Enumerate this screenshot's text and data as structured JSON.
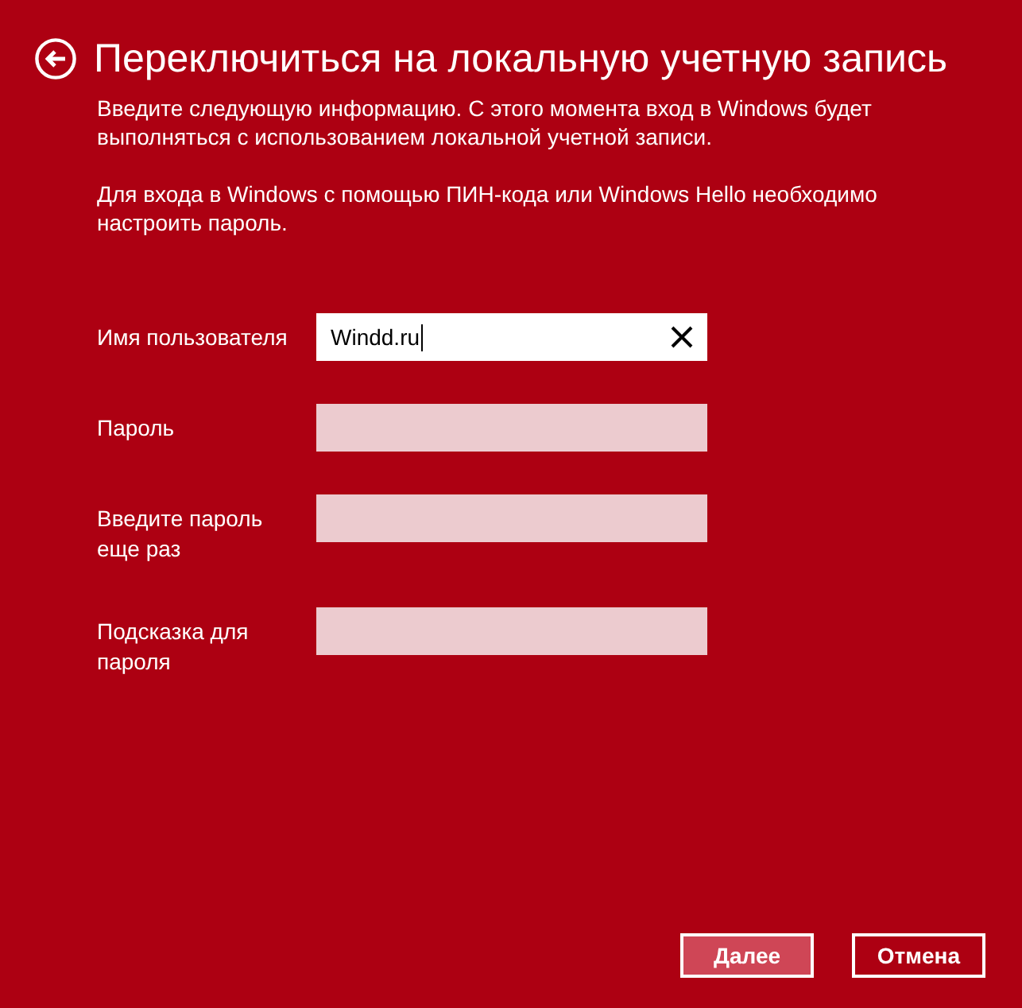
{
  "header": {
    "title": "Переключиться на локальную учетную запись"
  },
  "paragraphs": [
    "Введите следующую информацию. С этого момента вход в Windows будет выполняться с использованием локальной учетной записи.",
    "Для входа в Windows с помощью ПИН-кода или Windows Hello необходимо настроить пароль."
  ],
  "fields": [
    {
      "label": "Имя пользователя",
      "value": "Windd.ru",
      "focused": true
    },
    {
      "label": "Пароль",
      "focused": false
    },
    {
      "label": "Введите пароль еще раз",
      "focused": false
    },
    {
      "label": "Подсказка для пароля",
      "focused": false
    }
  ],
  "buttons": [
    {
      "label": "Далее",
      "default": true
    },
    {
      "label": "Отмена",
      "default": false
    }
  ]
}
